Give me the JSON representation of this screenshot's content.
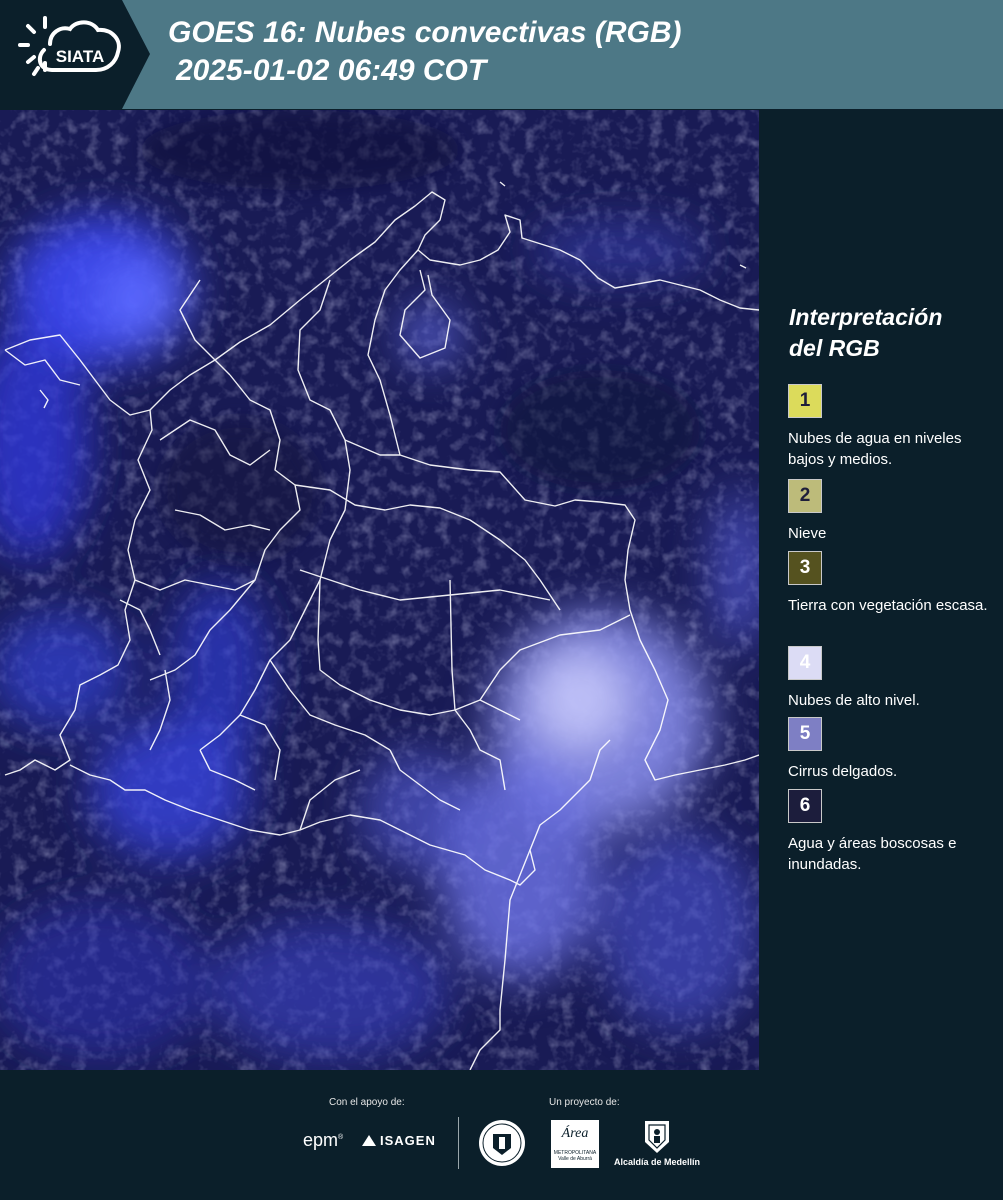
{
  "header": {
    "logo_text": "SIATA",
    "title_line1": "GOES 16: Nubes convectivas (RGB)",
    "title_line2": "2025-01-02 06:49 COT"
  },
  "legend": {
    "title_line1": "Interpretación",
    "title_line2": "del RGB",
    "items": [
      {
        "number": "1",
        "color": "#dcdb5b",
        "label": "Nubes de agua en niveles bajos y medios."
      },
      {
        "number": "2",
        "color": "#bdbb7a",
        "label": "Nieve"
      },
      {
        "number": "3",
        "color": "#55521f",
        "label": "Tierra con vegetación escasa."
      },
      {
        "number": "4",
        "color": "#dcdcf5",
        "label": "Nubes de alto nivel."
      },
      {
        "number": "5",
        "color": "#7e7fc4",
        "label": "Cirrus delgados."
      },
      {
        "number": "6",
        "color": "#1c1d3c",
        "label": "Agua y áreas boscosas e inundadas."
      }
    ]
  },
  "footer": {
    "support_label": "Con el apoyo de:",
    "project_label": "Un proyecto de:",
    "partners": {
      "epm": "epm",
      "isagen": "ISAGEN",
      "area_main": "Área",
      "area_sub1": "METROPOLITANA",
      "area_sub2": "Valle de Aburrá",
      "alcaldia": "Alcaldía de Medellín"
    }
  },
  "colors": {
    "header_bg": "#4d7886",
    "panel_bg": "#0b1f2a",
    "map_bg": "#181a52"
  }
}
